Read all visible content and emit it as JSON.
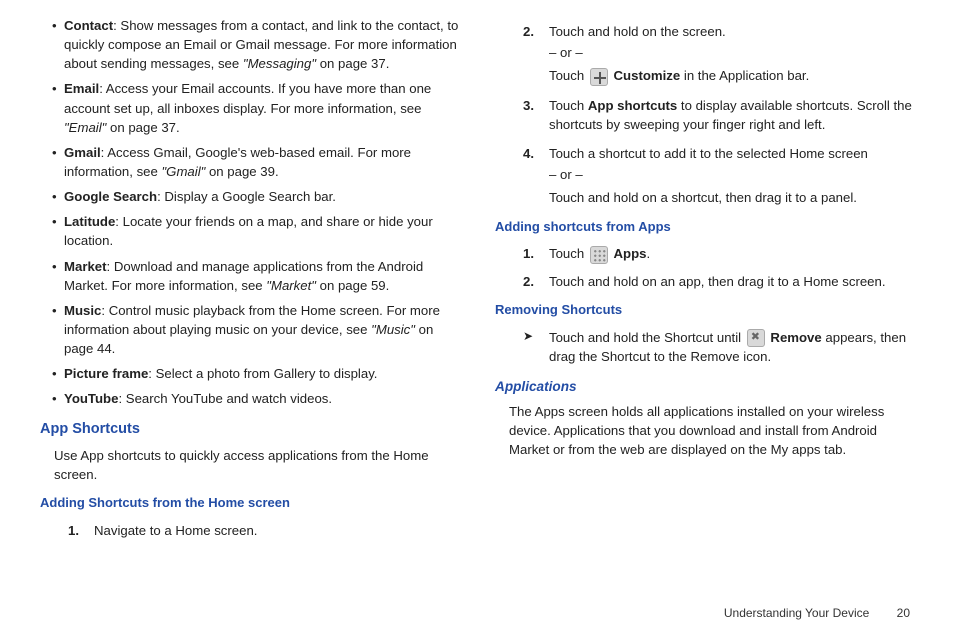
{
  "leftColumn": {
    "bullets": [
      {
        "label": "Contact",
        "text1": ": Show messages from a contact, and link to the contact, to quickly compose an Email or Gmail message. For more information about sending messages, see ",
        "ref": "\"Messaging\"",
        "text2": " on page 37."
      },
      {
        "label": "Email",
        "text1": ": Access your Email accounts. If you have more than one account set up, all inboxes display. For more information, see ",
        "ref": "\"Email\"",
        "text2": " on page 37."
      },
      {
        "label": "Gmail",
        "text1": ": Access Gmail, Google's web-based email. For more information, see ",
        "ref": "\"Gmail\"",
        "text2": " on page 39."
      },
      {
        "label": "Google Search",
        "text1": ": Display a Google Search bar.",
        "ref": "",
        "text2": ""
      },
      {
        "label": "Latitude",
        "text1": ": Locate your friends on a map, and share or hide your location.",
        "ref": "",
        "text2": ""
      },
      {
        "label": "Market",
        "text1": ": Download and manage applications from the Android Market. For more information, see ",
        "ref": "\"Market\"",
        "text2": " on page 59."
      },
      {
        "label": "Music",
        "text1": ": Control music playback from the Home screen. For more information about playing music on your device, see ",
        "ref": "\"Music\"",
        "text2": " on page 44."
      },
      {
        "label": "Picture frame",
        "text1": ": Select a photo from Gallery to display.",
        "ref": "",
        "text2": ""
      },
      {
        "label": "YouTube",
        "text1": ": Search YouTube and watch videos.",
        "ref": "",
        "text2": ""
      }
    ],
    "appShortcutsHeading": "App Shortcuts",
    "appShortcutsBody": "Use App shortcuts to quickly access applications from the Home screen.",
    "addingFromHomeHeading": "Adding Shortcuts from the Home screen",
    "step1": {
      "num": "1.",
      "text": "Navigate to a Home screen."
    }
  },
  "rightColumn": {
    "step2": {
      "num": "2.",
      "line1": "Touch and hold on the screen.",
      "or": "– or –",
      "line2a": "Touch ",
      "line2b": "Customize",
      "line2c": " in the Application bar."
    },
    "step3": {
      "num": "3.",
      "textA": "Touch ",
      "bold": "App shortcuts",
      "textB": " to display available shortcuts. Scroll the shortcuts by sweeping your finger right and left."
    },
    "step4": {
      "num": "4.",
      "line1": "Touch a shortcut to add it to the selected Home screen",
      "or": "– or –",
      "line2": "Touch and hold on a shortcut, then drag it to a panel."
    },
    "addingFromAppsHeading": "Adding shortcuts from Apps",
    "appsStep1": {
      "num": "1.",
      "textA": "Touch ",
      "bold": "Apps",
      "textB": "."
    },
    "appsStep2": {
      "num": "2.",
      "text": "Touch and hold on an app, then drag it to a Home screen."
    },
    "removingHeading": "Removing Shortcuts",
    "removing": {
      "textA": "Touch and hold the Shortcut until ",
      "bold": "Remove",
      "textB": " appears, then drag the Shortcut to the Remove icon."
    },
    "applicationsHeading": "Applications",
    "applicationsBody": "The Apps screen holds all applications installed on your wireless device. Applications that you download and install from Android Market or from the web are displayed on the My apps tab."
  },
  "footer": {
    "section": "Understanding Your Device",
    "page": "20"
  }
}
